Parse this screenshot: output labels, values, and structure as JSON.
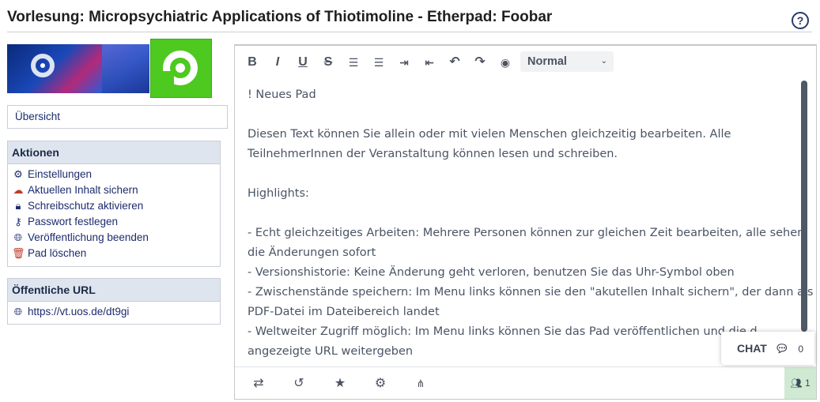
{
  "page_title": "Vorlesung: Micropsychiatric Applications of Thiotimoline - Etherpad: Foobar",
  "help_icon": "?",
  "sidebar": {
    "overview_label": "Übersicht",
    "actions": {
      "header": "Aktionen",
      "items": [
        {
          "label": "Einstellungen",
          "icon": "gears-icon"
        },
        {
          "label": "Aktuellen Inhalt sichern",
          "icon": "cloud-save-icon"
        },
        {
          "label": "Schreibschutz aktivieren",
          "icon": "lock-icon"
        },
        {
          "label": "Passwort festlegen",
          "icon": "key-icon"
        },
        {
          "label": "Veröffentlichung beenden",
          "icon": "globe-icon"
        },
        {
          "label": "Pad löschen",
          "icon": "trash-icon"
        }
      ]
    },
    "public_url": {
      "header": "Öffentliche URL",
      "url": "https://vt.uos.de/dt9gi"
    }
  },
  "toolbar": {
    "buttons": [
      "B",
      "I",
      "U",
      "S"
    ],
    "paragraph_style": "Normal"
  },
  "editor": {
    "lines": [
      "! Neues Pad",
      "",
      "Diesen Text können Sie allein oder mit vielen Menschen gleichzeitig bearbeiten. Alle",
      "TeilnehmerInnen der Veranstaltung können lesen und schreiben.",
      "",
      "Highlights:",
      "",
      "- Echt gleichzeitiges Arbeiten: Mehrere Personen können zur gleichen Zeit bearbeiten, alle sehen",
      "die Änderungen sofort",
      "- Versionshistorie: Keine Änderung geht verloren, benutzen Sie das Uhr-Symbol oben",
      "- Zwischenstände speichern: Im Menu links können sie den \"akutellen Inhalt sichern\", der dann als",
      "PDF-Datei im Dateibereich landet",
      "- Weltweiter Zugriff möglich: Im Menu links können Sie das Pad veröffentlichen und die d",
      "angezeigte URL weitergeben"
    ]
  },
  "chat": {
    "label": "CHAT",
    "count": "0"
  },
  "users_count": "1"
}
